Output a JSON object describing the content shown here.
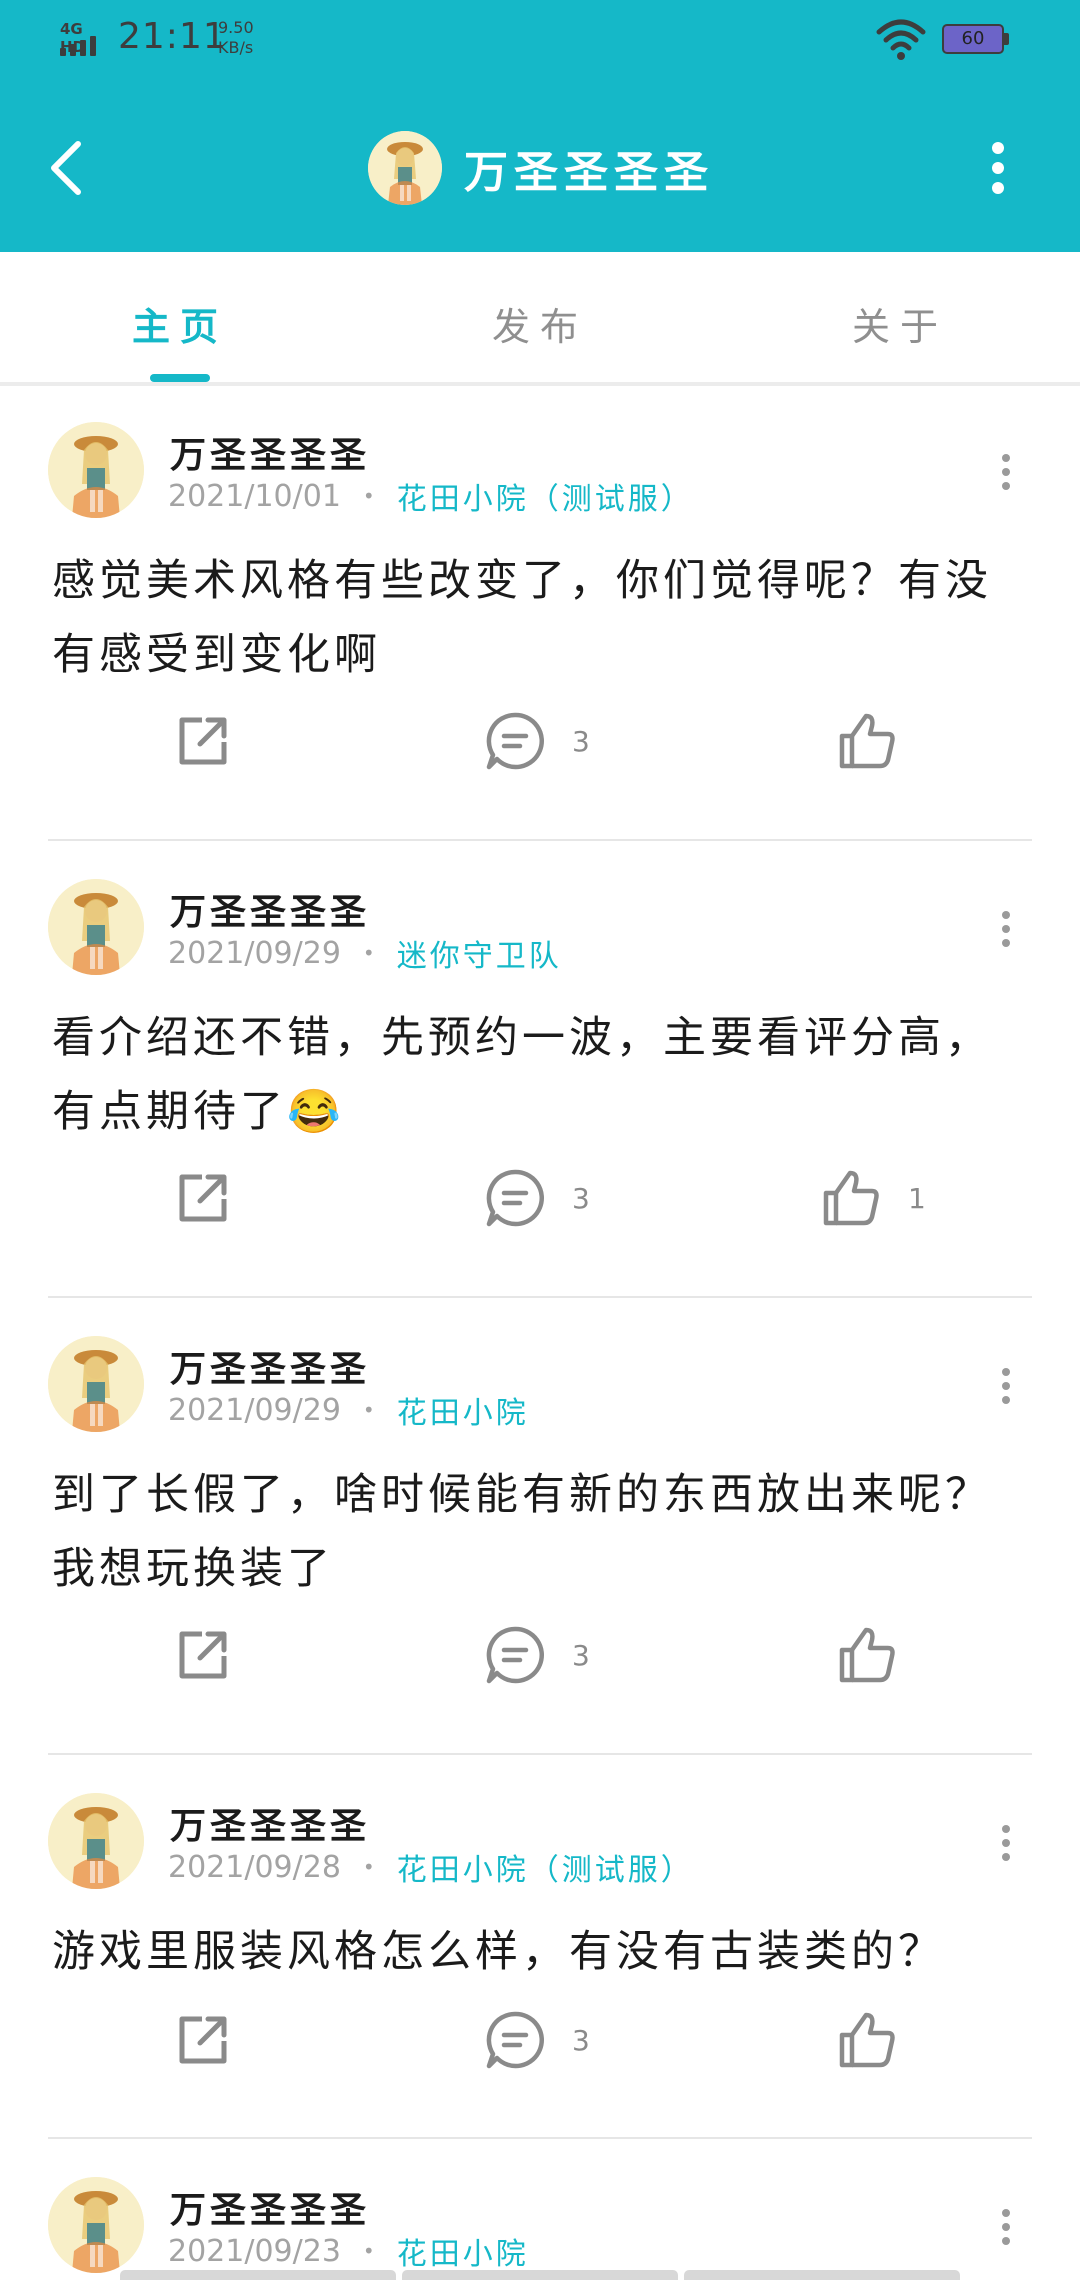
{
  "status_bar": {
    "network": "4G HD",
    "time": "21:11",
    "speed_value": "9.50",
    "speed_unit": "KB/s",
    "battery": "60"
  },
  "header": {
    "title": "万圣圣圣圣",
    "bg_color": "#15b8c8",
    "icons": [
      "back-arrow-icon",
      "more-vertical-icon"
    ]
  },
  "tabs": [
    {
      "label": "主页",
      "active": true
    },
    {
      "label": "发布",
      "active": false
    },
    {
      "label": "关于",
      "active": false
    }
  ],
  "posts": [
    {
      "author": "万圣圣圣圣",
      "date": "2021/10/01",
      "tag": "花田小院（测试服）",
      "text": "感觉美术风格有些改变了，你们觉得呢？有没有感受到变化啊",
      "comments": "3",
      "likes": ""
    },
    {
      "author": "万圣圣圣圣",
      "date": "2021/09/29",
      "tag": "迷你守卫队",
      "text": "看介绍还不错，先预约一波，主要看评分高，有点期待了😂",
      "comments": "3",
      "likes": "1"
    },
    {
      "author": "万圣圣圣圣",
      "date": "2021/09/29",
      "tag": "花田小院",
      "text": "到了长假了，啥时候能有新的东西放出来呢？我想玩换装了",
      "comments": "3",
      "likes": ""
    },
    {
      "author": "万圣圣圣圣",
      "date": "2021/09/28",
      "tag": "花田小院（测试服）",
      "text": "游戏里服装风格怎么样，有没有古装类的？",
      "comments": "3",
      "likes": ""
    },
    {
      "author": "万圣圣圣圣",
      "date": "2021/09/23",
      "tag": "花田小院",
      "text": "",
      "comments": "",
      "likes": ""
    }
  ],
  "action_icons": [
    "share-icon",
    "comment-icon",
    "like-icon"
  ],
  "accent_color": "#15b8c8"
}
